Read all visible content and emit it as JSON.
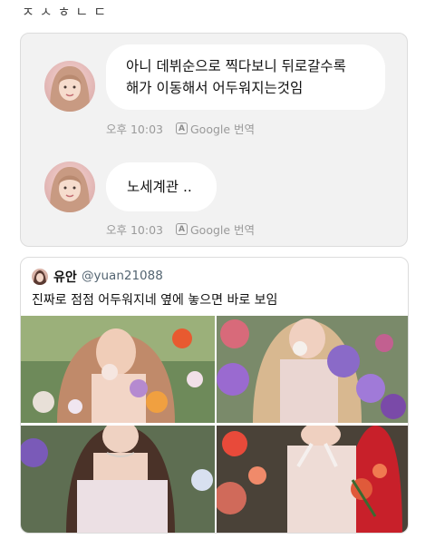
{
  "header": {
    "text": "ㅈㅅㅎㄴㄷ"
  },
  "chat": {
    "messages": [
      {
        "lines": [
          "아니 데뷔순으로 찍다보니 뒤로갈수록",
          "해가 이동해서 어두워지는것임"
        ],
        "time": "오후 10:03",
        "translate_label": "Google 번역"
      },
      {
        "lines": [
          "노세계관 .."
        ],
        "time": "오후 10:03",
        "translate_label": "Google 번역"
      }
    ],
    "translate_badge": "A"
  },
  "tweet": {
    "name": "유안",
    "handle": "@yuan21088",
    "text": "진짜로 점점 어두워지네 옆에 놓으면 바로 보임"
  }
}
